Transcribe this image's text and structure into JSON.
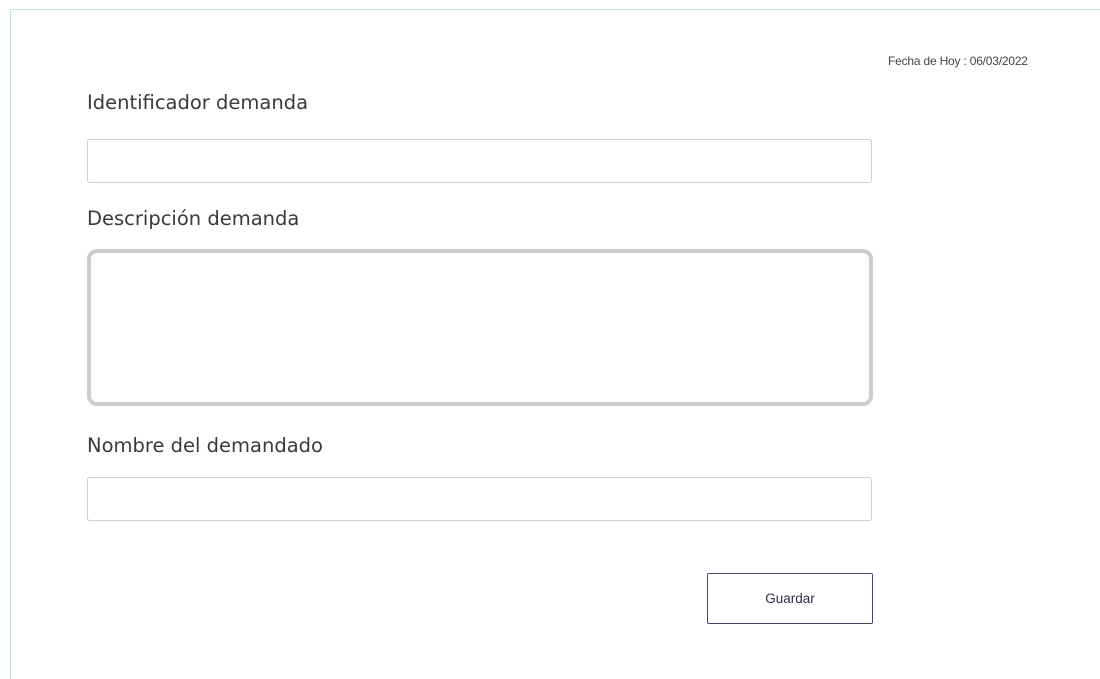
{
  "header": {
    "date_label": "Fecha de Hoy :",
    "date_value": "06/03/2022"
  },
  "form": {
    "identificador": {
      "label": "Identificador demanda",
      "value": "",
      "placeholder": ""
    },
    "descripcion": {
      "label": "Descripción demanda",
      "value": "",
      "placeholder": ""
    },
    "nombre_demandado": {
      "label": "Nombre del demandado",
      "value": "",
      "placeholder": ""
    },
    "save_label": "Guardar"
  },
  "colors": {
    "frame_border": "#c9dee3",
    "input_border": "#cfcfcf",
    "textarea_border": "#cdcdcd",
    "button_border": "#4a4566",
    "label_text": "#3a3a3a"
  }
}
